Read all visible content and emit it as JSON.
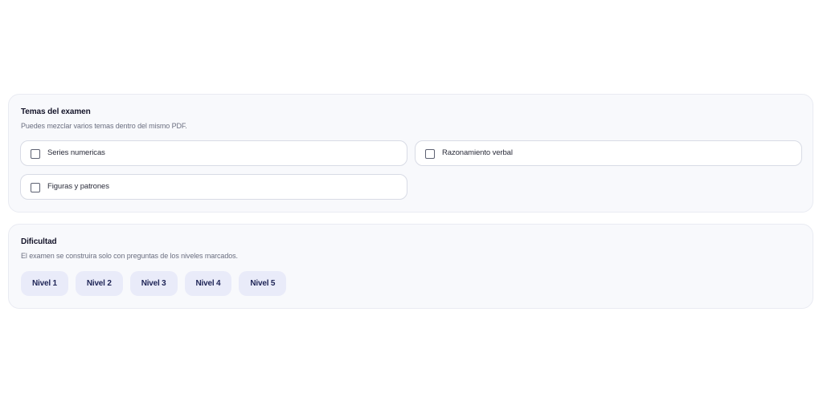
{
  "temas": {
    "title": "Temas del examen",
    "description": "Puedes mezclar varios temas dentro del mismo PDF.",
    "topics": [
      {
        "label": "Series numericas",
        "checked": false
      },
      {
        "label": "Razonamiento verbal",
        "checked": false
      },
      {
        "label": "Figuras y patrones",
        "checked": false
      }
    ]
  },
  "dificultad": {
    "title": "Dificultad",
    "description": "El examen se construira solo con preguntas de los niveles marcados.",
    "levels": [
      "Nivel 1",
      "Nivel 2",
      "Nivel 3",
      "Nivel 4",
      "Nivel 5"
    ]
  },
  "colors": {
    "card_background": "#f8f9fc",
    "chip_background": "#e9ebf9",
    "chip_text": "#1e2456"
  }
}
